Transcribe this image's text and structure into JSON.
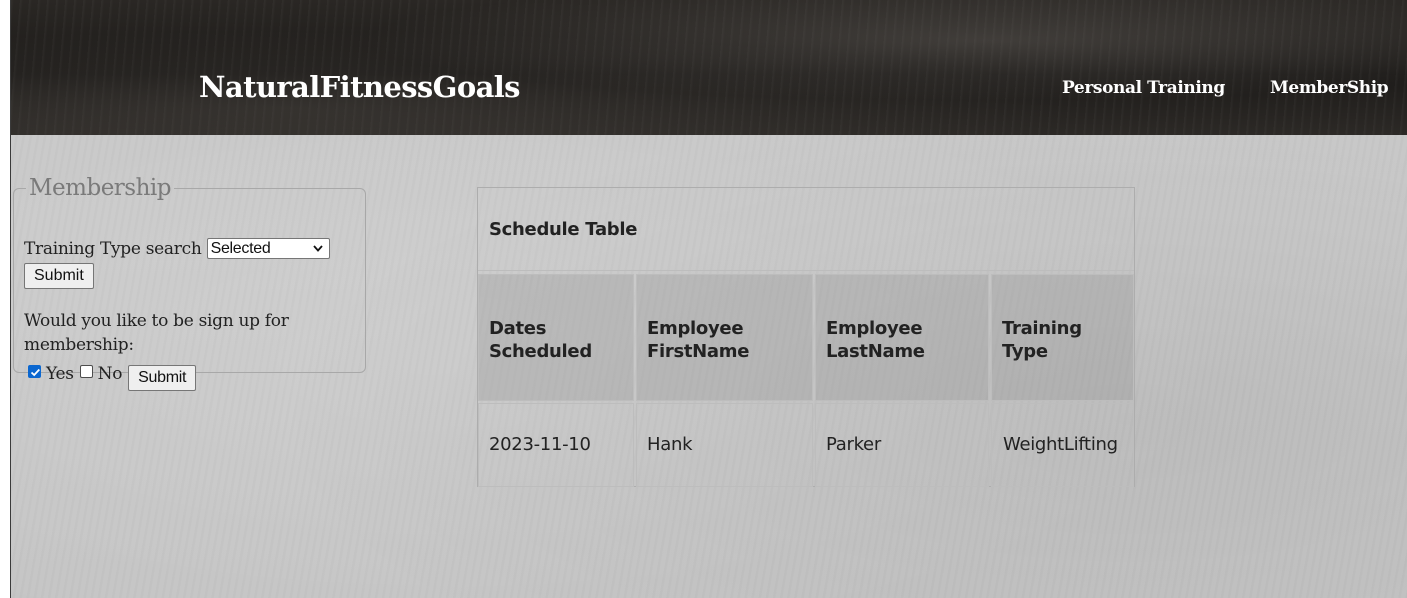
{
  "header": {
    "brand": "NaturalFitnessGoals",
    "nav": [
      {
        "label": "Personal Training"
      },
      {
        "label": "MemberShip"
      }
    ]
  },
  "membership_form": {
    "legend": "Membership",
    "search_label": "Training Type search",
    "select_value": "Selected",
    "submit_label": "Submit",
    "question": "Would you like to be sign up for membership:",
    "yes_label": "Yes",
    "yes_checked": true,
    "no_label": "No",
    "no_checked": false,
    "submit2_label": "Submit"
  },
  "schedule": {
    "caption": "Schedule Table",
    "headers": [
      "Dates Scheduled",
      "Employee FirstName",
      "Employee LastName",
      "Training Type"
    ],
    "rows": [
      [
        "2023-11-10",
        "Hank",
        "Parker",
        "WeightLifting"
      ]
    ]
  },
  "colors": {
    "header_bg": "#1d1b19",
    "page_bg": "#c7c7c7",
    "checkbox_accent": "#0b67d0"
  }
}
